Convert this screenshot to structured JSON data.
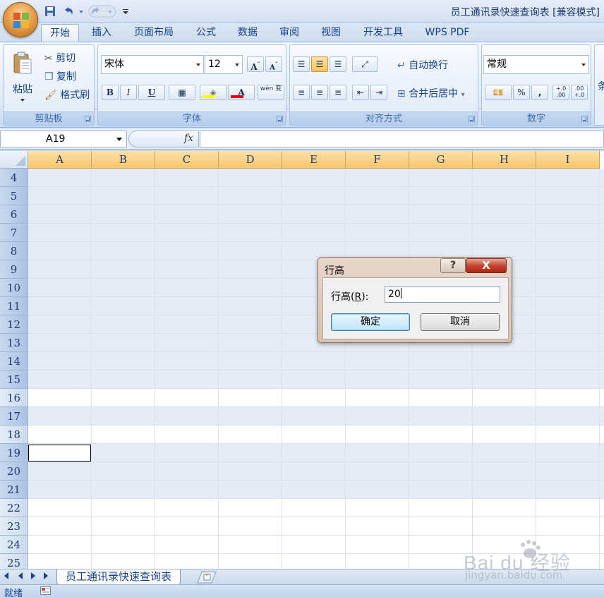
{
  "app": {
    "document_title": "员工通讯录快速查询表",
    "compat_mode": "[兼容模式]"
  },
  "tabs": [
    "开始",
    "插入",
    "页面布局",
    "公式",
    "数据",
    "审阅",
    "视图",
    "开发工具",
    "WPS PDF"
  ],
  "ribbon": {
    "clipboard": {
      "label": "剪贴板",
      "paste": "粘贴",
      "cut": "剪切",
      "copy": "复制",
      "format_painter": "格式刷"
    },
    "font": {
      "label": "字体",
      "font_name": "宋体",
      "font_size": "12",
      "bold": "B",
      "italic": "I",
      "underline": "U",
      "phonetic": "wén 变"
    },
    "alignment": {
      "label": "对齐方式",
      "wrap_text": "自动换行",
      "merge_center": "合并后居中"
    },
    "number": {
      "label": "数字",
      "format": "常规",
      "percent": "%",
      "comma": ",",
      "inc_decimal": "+.0 .00",
      "dec_decimal": ".00 +.0"
    },
    "styles_partial": "条"
  },
  "formula_bar": {
    "name_box": "A19",
    "fx": "fx",
    "formula": ""
  },
  "sheet": {
    "columns": [
      "A",
      "B",
      "C",
      "D",
      "E",
      "F",
      "G",
      "H",
      "I"
    ],
    "rows": [
      {
        "label": "4",
        "selected": true
      },
      {
        "label": "5",
        "selected": true
      },
      {
        "label": "6",
        "selected": true
      },
      {
        "label": "7",
        "selected": true
      },
      {
        "label": "8",
        "selected": true
      },
      {
        "label": "9",
        "selected": true
      },
      {
        "label": "10",
        "selected": true
      },
      {
        "label": "11",
        "selected": true
      },
      {
        "label": "12",
        "selected": true
      },
      {
        "label": "13",
        "selected": true
      },
      {
        "label": "14",
        "selected": true
      },
      {
        "label": "15",
        "selected": true
      },
      {
        "label": "16",
        "selected": false
      },
      {
        "label": "17",
        "selected": true
      },
      {
        "label": "18",
        "selected": false
      },
      {
        "label": "19",
        "selected": true
      },
      {
        "label": "20",
        "selected": true
      },
      {
        "label": "21",
        "selected": true
      },
      {
        "label": "22",
        "selected": false
      },
      {
        "label": "23",
        "selected": false
      },
      {
        "label": "24",
        "selected": false
      },
      {
        "label": "25",
        "selected": false
      }
    ],
    "active_cell": "A19",
    "tab_name": "员工通讯录快速查询表"
  },
  "dialog": {
    "title": "行高",
    "help": "?",
    "close": "X",
    "field_label_prefix": "行高(",
    "field_label_key": "R",
    "field_label_suffix": "):",
    "value": "20",
    "ok": "确定",
    "cancel": "取消"
  },
  "status": {
    "text": "就绪"
  },
  "watermark": {
    "brand": "Bai du 经验",
    "url": "jingyan.baidu.com"
  },
  "colors": {
    "accent": "#15428b",
    "column_header": "#f8c571",
    "selected_row": "#e6ebf5",
    "dialog_close": "#c0402b"
  }
}
